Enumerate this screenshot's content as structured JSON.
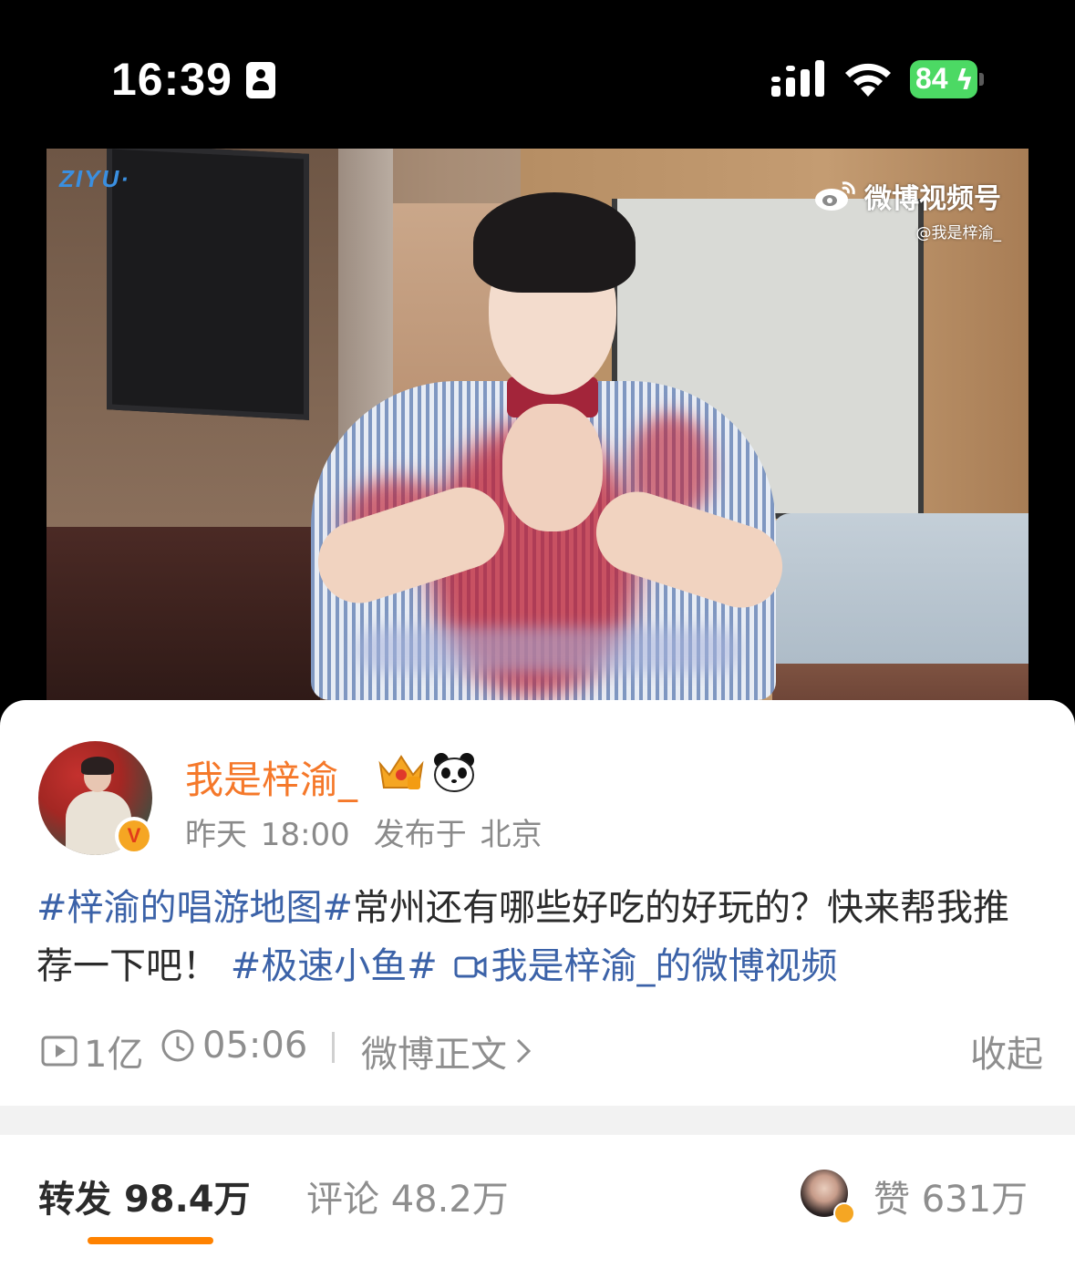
{
  "status_bar": {
    "time": "16:39",
    "battery": "84"
  },
  "video": {
    "channel_logo": "ZIYU·",
    "watermark_main": "微博视频号",
    "watermark_sub": "@我是梓渝_"
  },
  "post": {
    "username": "我是梓渝_",
    "time": "昨天 18:00",
    "location": "发布于 北京",
    "text": {
      "tag1": "#梓渝的唱游地图#",
      "body": "常州还有哪些好吃的好玩的？快来帮我推荐一下吧！",
      "tag2": "#极速小鱼#",
      "video_link": "我是梓渝_的微博视频"
    },
    "stats": {
      "views": "1亿",
      "duration": "05:06",
      "original_link": "微博正文",
      "collapse": "收起"
    }
  },
  "actions": {
    "repost_label": "转发",
    "repost_count": "98.4万",
    "comment_label": "评论",
    "comment_count": "48.2万",
    "like_label": "赞",
    "like_count": "631万"
  },
  "icons": [
    "portrait-lock-icon",
    "signal-icon",
    "wifi-icon",
    "battery-icon",
    "weibo-logo-icon",
    "verified-badge-icon",
    "crown-icon",
    "panda-icon",
    "video-link-icon",
    "play-count-icon",
    "clock-icon",
    "chevron-right-icon"
  ],
  "colors": {
    "username": "#f5782a",
    "hashtag": "#3b62a8",
    "tab_underline": "#ff8200",
    "battery": "#4cd964"
  }
}
